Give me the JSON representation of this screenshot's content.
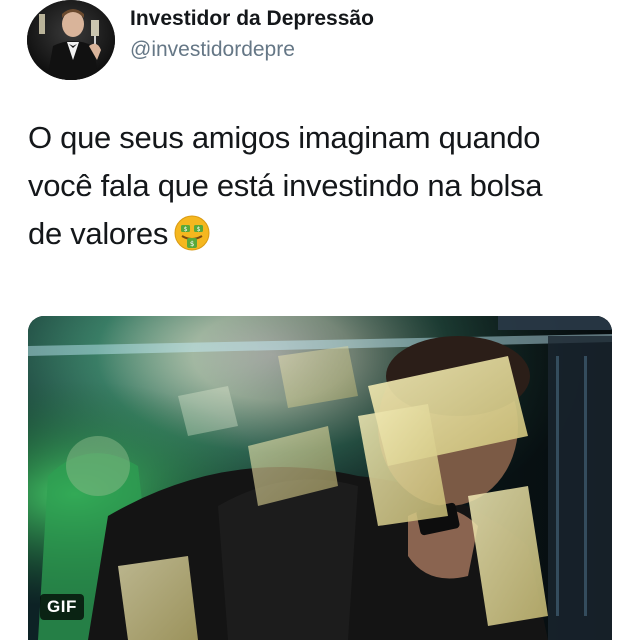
{
  "author": {
    "display_name": "Investidor da Depressão",
    "handle": "@investidordepre"
  },
  "tweet": {
    "text_lines": [
      "O que seus amigos imaginam quando",
      "você fala que está investindo na bolsa",
      "de valores"
    ],
    "emoji_icon": "money-mouth-face-icon"
  },
  "media": {
    "badge": "GIF"
  }
}
